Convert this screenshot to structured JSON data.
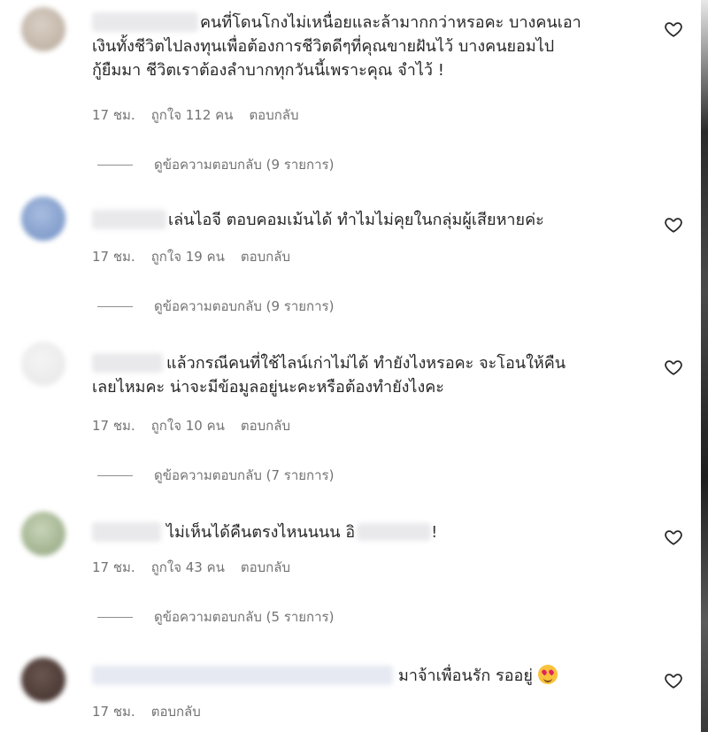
{
  "comments": [
    {
      "text": "คนที่โดนโกงไม่เหนื่อยและล้ามากกว่าหรอคะ บางคนเอา\nเงินทั้งชีวิตไปลงทุนเพื่อต้องการชีวิตดีๆที่คุณขายฝันไว้ บางคนยอมไป\nกู้ยืมมา ชีวิตเราต้องลำบากทุกวันนี้เพราะคุณ จำไว้ !",
      "time": "17 ชม.",
      "likes": "ถูกใจ 112 คน",
      "reply": "ตอบกลับ",
      "thread": "ดูข้อความตอบกลับ (9 รายการ)"
    },
    {
      "text": "เล่นไอจี ตอบคอมเม้นได้ ทำไมไม่คุยในกลุ่มผู้เสียหายค่ะ",
      "time": "17 ชม.",
      "likes": "ถูกใจ 19 คน",
      "reply": "ตอบกลับ",
      "thread": "ดูข้อความตอบกลับ (9 รายการ)"
    },
    {
      "text": "แล้วกรณีคนที่ใช้ไลน์เก่าไม่ได้ ทำยังไงหรอคะ จะโอนให้คืน\nเลยไหมคะ น่าจะมีข้อมูลอยู่นะคะหรือต้องทำยังไงคะ",
      "time": "17 ชม.",
      "likes": "ถูกใจ 10 คน",
      "reply": "ตอบกลับ",
      "thread": "ดูข้อความตอบกลับ (7 รายการ)"
    },
    {
      "text_a": "ไม่เห็นได้คืนตรงไหนนนน อิ",
      "text_b": "!",
      "time": "17 ชม.",
      "likes": "ถูกใจ 43 คน",
      "reply": "ตอบกลับ",
      "thread": "ดูข้อความตอบกลับ (5 รายการ)"
    },
    {
      "text": "มาจ้าเพื่อนรัก รออยู่",
      "emoji": "smiling-face-with-hearts",
      "time": "17 ชม.",
      "reply": "ตอบกลับ"
    }
  ],
  "icons": {
    "like": "heart-outline-icon"
  },
  "colors": {
    "text": "#262626",
    "meta": "#737373",
    "background": "#ffffff"
  }
}
